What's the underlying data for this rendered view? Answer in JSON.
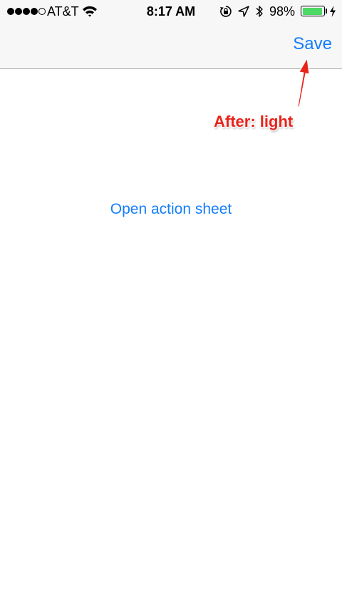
{
  "status_bar": {
    "carrier": "AT&T",
    "time": "8:17 AM",
    "battery_percent": "98%",
    "battery_level": 0.98,
    "signal_bars": 4,
    "icons": [
      "wifi-icon",
      "rotation-lock-icon",
      "location-icon",
      "bluetooth-icon",
      "battery-icon",
      "charging-bolt-icon"
    ],
    "battery_color": "#4cd964"
  },
  "nav_bar": {
    "save_label": "Save"
  },
  "annotation": {
    "text": "After: light",
    "color": "#e8231a"
  },
  "main": {
    "open_action_sheet_label": "Open action sheet"
  },
  "colors": {
    "accent": "#147efb",
    "nav_background": "#f7f7f7"
  }
}
